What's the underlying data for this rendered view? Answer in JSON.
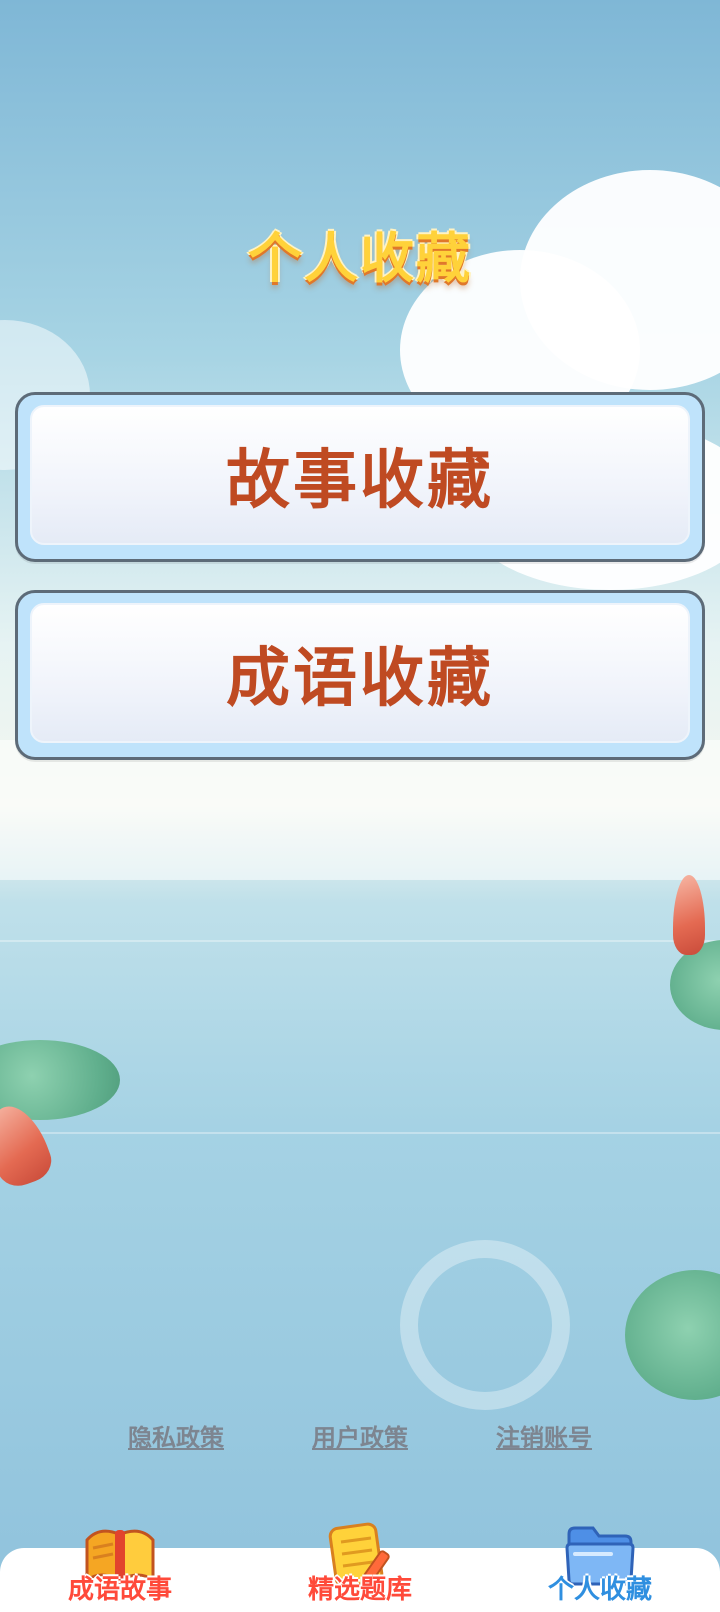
{
  "header": {
    "title": "个人收藏"
  },
  "cards": [
    {
      "label": "故事收藏"
    },
    {
      "label": "成语收藏"
    }
  ],
  "footer_links": [
    {
      "label": "隐私政策"
    },
    {
      "label": "用户政策"
    },
    {
      "label": "注销账号"
    }
  ],
  "tabbar": {
    "items": [
      {
        "label": "成语故事",
        "icon": "book-scroll-icon",
        "active": false
      },
      {
        "label": "精选题库",
        "icon": "question-bank-icon",
        "active": false
      },
      {
        "label": "个人收藏",
        "icon": "folder-icon",
        "active": true
      }
    ]
  },
  "colors": {
    "title": "#ffd23a",
    "card_text": "#bf4a22",
    "tab_text": "#ff4a3a",
    "tab_text_active": "#2f8fe0",
    "link_text": "#7d8590"
  }
}
